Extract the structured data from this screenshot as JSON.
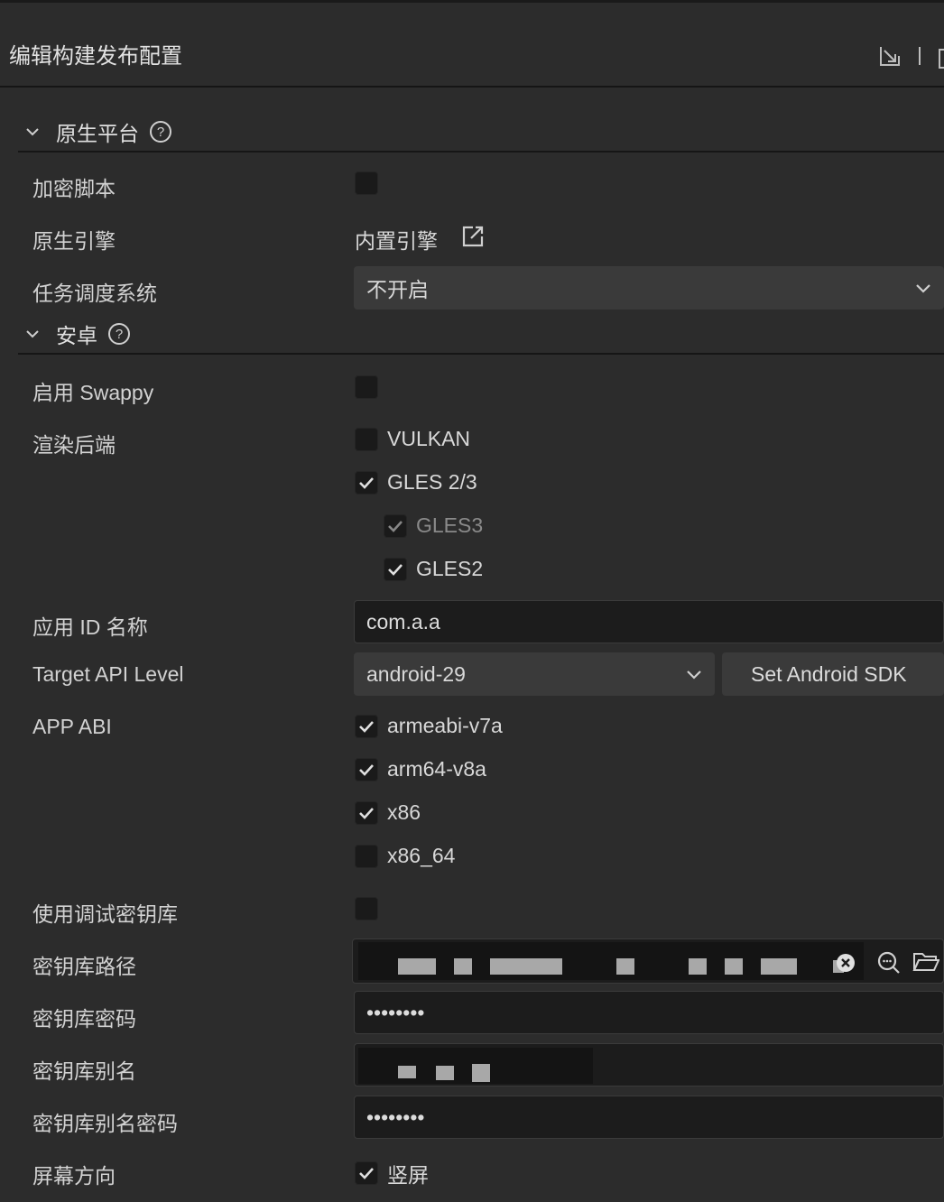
{
  "header": {
    "title": "编辑构建发布配置"
  },
  "sections": {
    "native": {
      "title": "原生平台",
      "help": "?"
    },
    "android": {
      "title": "安卓",
      "help": "?"
    }
  },
  "native": {
    "encrypt_label": "加密脚本",
    "engine_label": "原生引擎",
    "engine_value": "内置引擎",
    "task_label": "任务调度系统",
    "task_value": "不开启"
  },
  "android": {
    "swappy_label": "启用 Swappy",
    "render_label": "渲染后端",
    "render_options": [
      "VULKAN",
      "GLES 2/3",
      "GLES3",
      "GLES2"
    ],
    "render_checked": [
      false,
      true,
      true,
      true
    ],
    "appid_label": "应用 ID 名称",
    "appid_value": "com.a.a",
    "api_label": "Target API Level",
    "api_value": "android-29",
    "sdk_button": "Set Android SDK",
    "abi_label": "APP ABI",
    "abi_options": [
      "armeabi-v7a",
      "arm64-v8a",
      "x86",
      "x86_64"
    ],
    "abi_checked": [
      true,
      true,
      true,
      false
    ],
    "debug_keystore_label": "使用调试密钥库",
    "keystore_path_label": "密钥库路径",
    "keystore_pwd_label": "密钥库密码",
    "keystore_pwd_value": "••••••••",
    "alias_label": "密钥库别名",
    "alias_pwd_label": "密钥库别名密码",
    "alias_pwd_value": "••••••••",
    "orientation_label": "屏幕方向",
    "orientation_option": "竖屏"
  },
  "icons": [
    "export-icon",
    "chevron-down-icon",
    "help-icon",
    "external-link-icon",
    "check-icon",
    "clear-icon",
    "search-icon",
    "folder-icon"
  ],
  "colors": {
    "background": "#2c2c2c",
    "input_bg": "#1c1c1c",
    "select_bg": "#3a3a3a",
    "divider": "#161616"
  }
}
